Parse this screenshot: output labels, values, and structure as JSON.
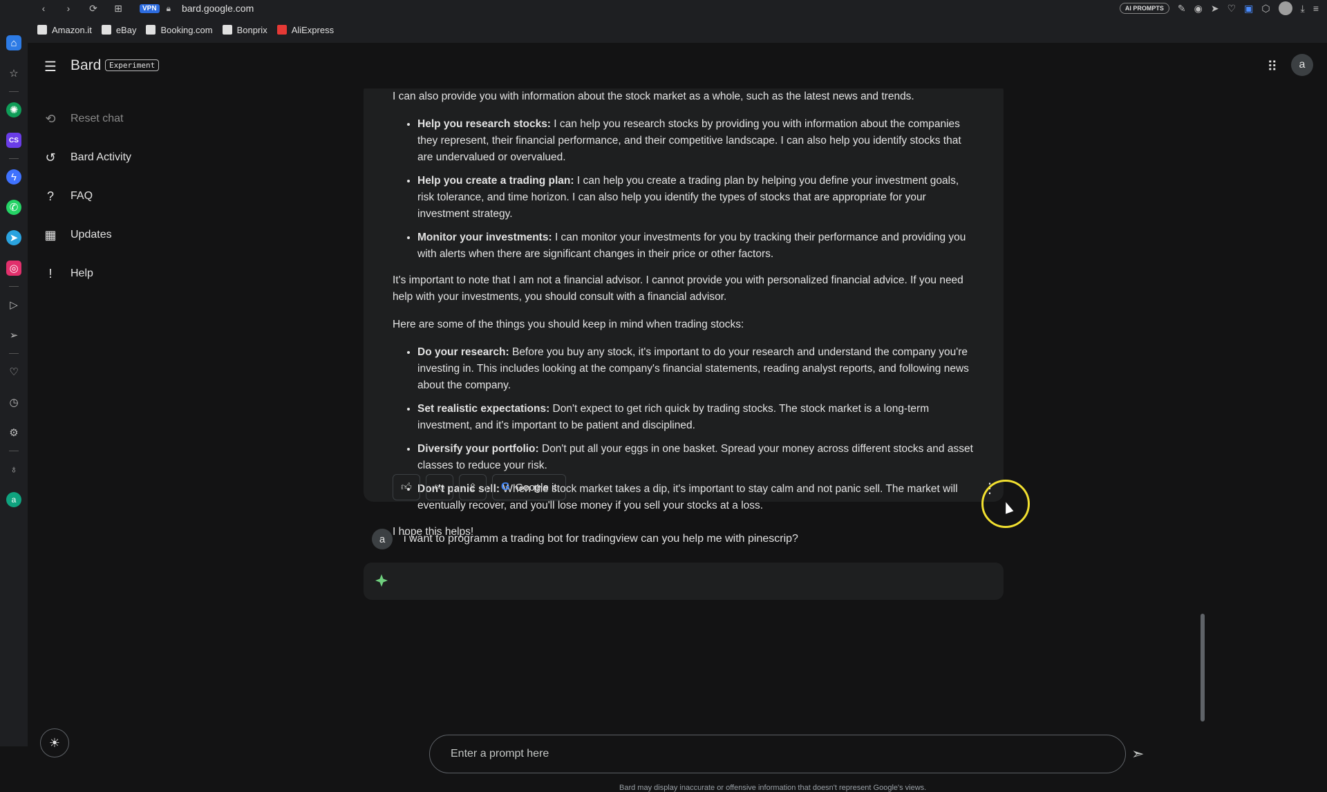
{
  "browser": {
    "vpn": "VPN",
    "url": "bard.google.com",
    "ai_prompts": "AI PROMPTS"
  },
  "bookmarks": [
    "Amazon.it",
    "eBay",
    "Booking.com",
    "Bonprix",
    "AliExpress"
  ],
  "header": {
    "brand": "Bard",
    "badge": "Experiment",
    "avatar_letter": "a"
  },
  "sidebar": {
    "items": [
      {
        "label": "Reset chat",
        "icon": "reset-icon"
      },
      {
        "label": "Bard Activity",
        "icon": "history-icon"
      },
      {
        "label": "FAQ",
        "icon": "help-circle-icon"
      },
      {
        "label": "Updates",
        "icon": "calendar-icon"
      },
      {
        "label": "Help",
        "icon": "feedback-icon"
      }
    ]
  },
  "response": {
    "intro_line": "I can also provide you with information about the stock market as a whole, such as the latest news and trends.",
    "bullets1": [
      {
        "bold": "Help you research stocks:",
        "text": " I can help you research stocks by providing you with information about the companies they represent, their financial performance, and their competitive landscape. I can also help you identify stocks that are undervalued or overvalued."
      },
      {
        "bold": "Help you create a trading plan:",
        "text": " I can help you create a trading plan by helping you define your investment goals, risk tolerance, and time horizon. I can also help you identify the types of stocks that are appropriate for your investment strategy."
      },
      {
        "bold": "Monitor your investments:",
        "text": " I can monitor your investments for you by tracking their performance and providing you with alerts when there are significant changes in their price or other factors."
      }
    ],
    "para1": "It's important to note that I am not a financial advisor. I cannot provide you with personalized financial advice. If you need help with your investments, you should consult with a financial advisor.",
    "para2": "Here are some of the things you should keep in mind when trading stocks:",
    "bullets2": [
      {
        "bold": "Do your research:",
        "text": " Before you buy any stock, it's important to do your research and understand the company you're investing in. This includes looking at the company's financial statements, reading analyst reports, and following news about the company."
      },
      {
        "bold": "Set realistic expectations:",
        "text": " Don't expect to get rich quick by trading stocks. The stock market is a long-term investment, and it's important to be patient and disciplined."
      },
      {
        "bold": "Diversify your portfolio:",
        "text": " Don't put all your eggs in one basket. Spread your money across different stocks and asset classes to reduce your risk."
      },
      {
        "bold": "Don't panic sell:",
        "text": " When the stock market takes a dip, it's important to stay calm and not panic sell. The market will eventually recover, and you'll lose money if you sell your stocks at a loss."
      }
    ],
    "closing": "I hope this helps!",
    "google_it": "Google it"
  },
  "user_message": {
    "avatar_letter": "a",
    "text": "i want to programm a trading bot for tradingview can you help me with pinescrip?"
  },
  "prompt": {
    "placeholder": "Enter a prompt here",
    "disclaimer": "Bard may display inaccurate or offensive information that doesn't represent Google's views."
  }
}
